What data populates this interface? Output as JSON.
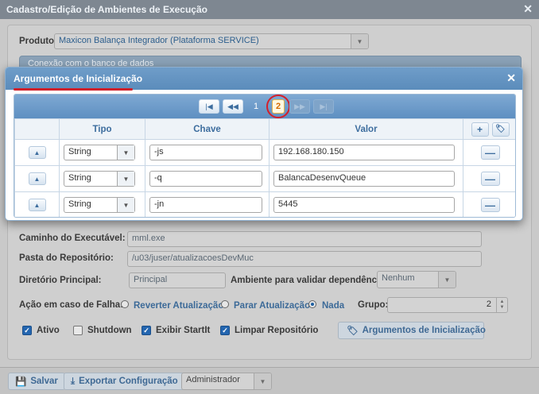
{
  "main": {
    "title": "Cadastro/Edição de Ambientes de Execução",
    "produto_label": "Produto:",
    "produto_value": "Maxicon Balança Integrador (Plataforma SERVICE)",
    "accordion_label": "Conexão com o banco de dados",
    "caminho_label": "Caminho do Executável:",
    "caminho_value": "mml.exe",
    "pasta_label": "Pasta do Repositório:",
    "pasta_value": "/u03/juser/atualizacoesDevMuc",
    "diretorio_label": "Diretório Principal:",
    "diretorio_value": "Principal",
    "ambiente_label": "Ambiente para validar dependências:",
    "ambiente_value": "Nenhum",
    "falha_label": "Ação em caso de Falha:",
    "falha_options": [
      "Reverter Atualização",
      "Parar Atualização",
      "Nada"
    ],
    "falha_selected": "Nada",
    "grupo_label": "Grupo:",
    "grupo_value": "2",
    "checks": [
      {
        "label": "Ativo",
        "checked": true
      },
      {
        "label": "Shutdown",
        "checked": false
      },
      {
        "label": "Exibir StartIt",
        "checked": true
      },
      {
        "label": "Limpar Repositório",
        "checked": true
      }
    ],
    "args_button": "Argumentos de Inicialização"
  },
  "footer": {
    "save": "Salvar",
    "export": "Exportar Configuração",
    "profile": "Administrador"
  },
  "modal": {
    "title": "Argumentos de Inicialização",
    "pager": {
      "pages": [
        "1",
        "2"
      ],
      "current": "2"
    },
    "columns": [
      "Tipo",
      "Chave",
      "Valor"
    ],
    "rows": [
      {
        "tipo": "String",
        "chave": "-js",
        "valor": "192.168.180.150"
      },
      {
        "tipo": "String",
        "chave": "-q",
        "valor": "BalancaDesenvQueue"
      },
      {
        "tipo": "String",
        "chave": "-jn",
        "valor": "5445"
      }
    ]
  },
  "colors": {
    "modal_title": "#5b8cbb",
    "annotation": "#d41f2a",
    "current_page": "#d46a00"
  }
}
